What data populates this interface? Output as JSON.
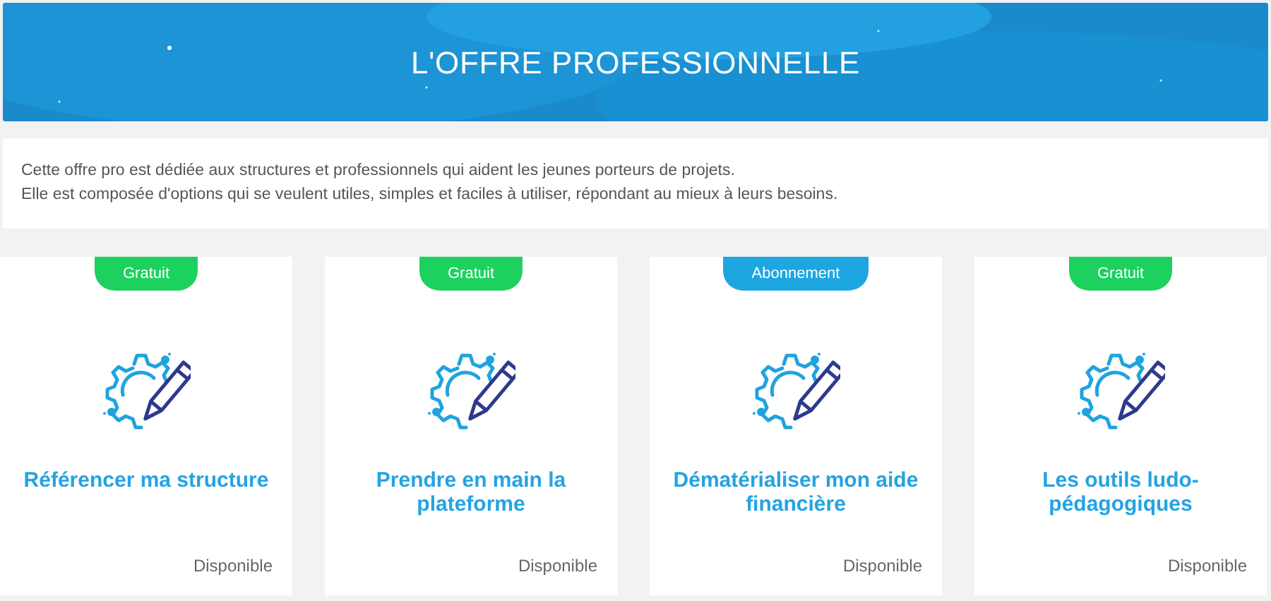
{
  "header": {
    "title": "L'OFFRE PROFESSIONNELLE"
  },
  "intro": {
    "lines": [
      "Cette offre pro est dédiée aux structures et professionnels qui aident les jeunes porteurs de projets.",
      "Elle est composée d'options qui se veulent utiles, simples et faciles à utiliser, répondant au mieux à leurs besoins."
    ]
  },
  "offers": [
    {
      "badge": "Gratuit",
      "color": "#1dd15f",
      "title": "Référencer ma structure",
      "status": "Disponible"
    },
    {
      "badge": "Gratuit",
      "color": "#1dd15f",
      "title": "Prendre en main la plateforme",
      "status": "Disponible"
    },
    {
      "badge": "Abonnement",
      "color": "#1ea6e0",
      "title": "Dématérialiser mon aide financière",
      "status": "Disponible"
    },
    {
      "badge": "Gratuit",
      "color": "#1dd15f",
      "title": "Les outils ludo-pédagogiques",
      "status": "Disponible"
    }
  ]
}
